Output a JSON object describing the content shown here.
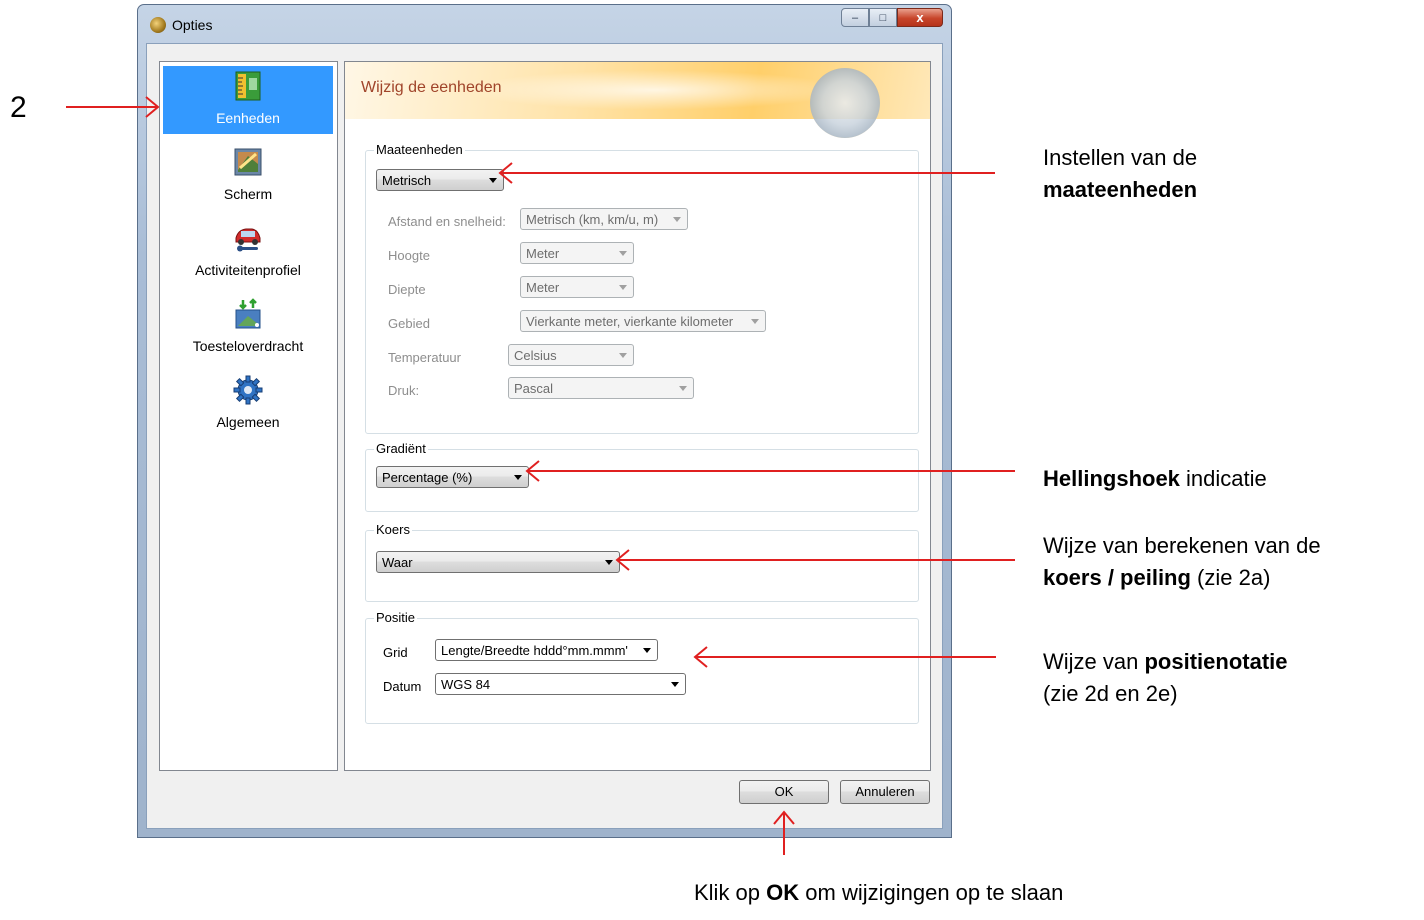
{
  "window": {
    "title": "Opties",
    "buttons": {
      "minimize": "–",
      "maximize": "□",
      "close": "x"
    }
  },
  "sidebar": {
    "items": [
      {
        "label": "Eenheden",
        "icon": "ruler-icon",
        "selected": true
      },
      {
        "label": "Scherm",
        "icon": "display-icon",
        "selected": false
      },
      {
        "label": "Activiteitenprofiel",
        "icon": "car-wrench-icon",
        "selected": false
      },
      {
        "label": "Toesteloverdracht",
        "icon": "device-transfer-icon",
        "selected": false
      },
      {
        "label": "Algemeen",
        "icon": "gear-icon",
        "selected": false
      }
    ]
  },
  "panel": {
    "title": "Wijzig de eenheden",
    "maateenheden": {
      "group_label": "Maateenheden",
      "mode": "Metrisch",
      "rows": [
        {
          "label": "Afstand en snelheid:",
          "value": "Metrisch (km, km/u, m)"
        },
        {
          "label": "Hoogte",
          "value": "Meter"
        },
        {
          "label": "Diepte",
          "value": "Meter"
        },
        {
          "label": "Gebied",
          "value": "Vierkante meter, vierkante kilometer"
        },
        {
          "label": "Temperatuur",
          "value": "Celsius"
        },
        {
          "label": "Druk:",
          "value": "Pascal"
        }
      ]
    },
    "gradient": {
      "group_label": "Gradiënt",
      "value": "Percentage (%)"
    },
    "koers": {
      "group_label": "Koers",
      "value": "Waar"
    },
    "positie": {
      "group_label": "Positie",
      "grid_label": "Grid",
      "grid_value": "Lengte/Breedte hddd°mm.mmm'",
      "datum_label": "Datum",
      "datum_value": "WGS 84"
    }
  },
  "footer": {
    "ok": "OK",
    "cancel": "Annuleren"
  },
  "annotations": {
    "step_number": "2",
    "units_line1": "Instellen van de",
    "units_bold": "maateenheden",
    "slope_bold": "Hellingshoek",
    "slope_rest": " indicatie",
    "course_line1": "Wijze van berekenen van de",
    "course_bold": "koers / peiling",
    "course_rest": "  (zie 2a)",
    "position_prefix": "Wijze van ",
    "position_bold": "positienotatie",
    "position_line2": " (zie 2d en 2e)",
    "ok_prefix": "Klik op ",
    "ok_bold": "OK",
    "ok_rest": " om wijzigingen op te slaan"
  },
  "colors": {
    "annotation_arrow": "#e02020",
    "selection": "#3399ff",
    "banner_title": "#a0442a"
  }
}
